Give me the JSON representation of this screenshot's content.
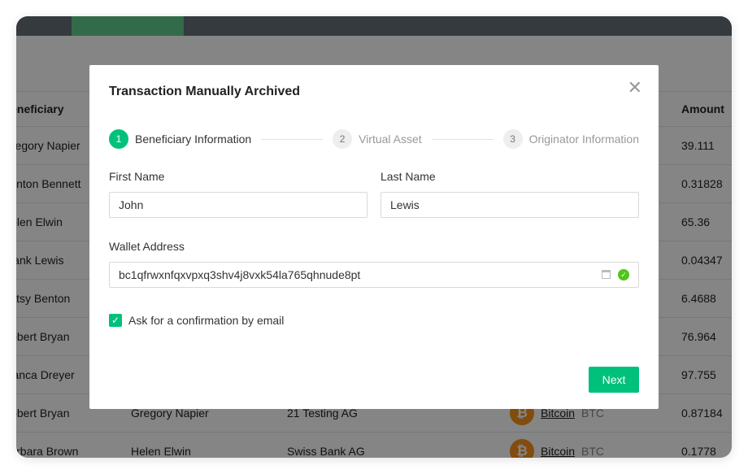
{
  "table": {
    "headers": {
      "beneficiary": "Beneficiary",
      "amount": "Amount"
    },
    "rows": [
      {
        "beneficiary": "Gregory Napier",
        "amount": "39.111"
      },
      {
        "beneficiary": "Benton Bennett",
        "amount": "0.31828"
      },
      {
        "beneficiary": "Helen Elwin",
        "amount": "65.36"
      },
      {
        "beneficiary": "Frank Lewis",
        "amount": "0.04347"
      },
      {
        "beneficiary": "Betsy Benton",
        "amount": "6.4688"
      },
      {
        "beneficiary": "Robert Bryan",
        "amount": "76.964"
      },
      {
        "beneficiary": "Bianca Dreyer",
        "amount": "97.755"
      },
      {
        "beneficiary": "Robert Bryan",
        "originator": "Gregory Napier",
        "vasp": "21 Testing AG",
        "asset": "Bitcoin",
        "symbol": "BTC",
        "amount": "0.87184"
      },
      {
        "beneficiary": "Barbara Brown",
        "originator": "Helen Elwin",
        "vasp": "Swiss Bank AG",
        "asset": "Bitcoin",
        "symbol": "BTC",
        "amount": "0.1778"
      }
    ]
  },
  "modal": {
    "title": "Transaction Manually Archived",
    "steps": [
      {
        "num": "1",
        "label": "Beneficiary Information"
      },
      {
        "num": "2",
        "label": "Virtual Asset"
      },
      {
        "num": "3",
        "label": "Originator Information"
      }
    ],
    "first_name_label": "First Name",
    "first_name": "John",
    "last_name_label": "Last Name",
    "last_name": "Lewis",
    "wallet_label": "Wallet Address",
    "wallet": "bc1qfrwxnfqxvpxq3shv4j8vxk54la765qhnude8pt",
    "confirm_label": "Ask for a confirmation by email",
    "confirm_checked": true,
    "next_label": "Next"
  },
  "colors": {
    "accent": "#00c17c",
    "valid": "#52c41a",
    "bitcoin": "#f7931a"
  }
}
